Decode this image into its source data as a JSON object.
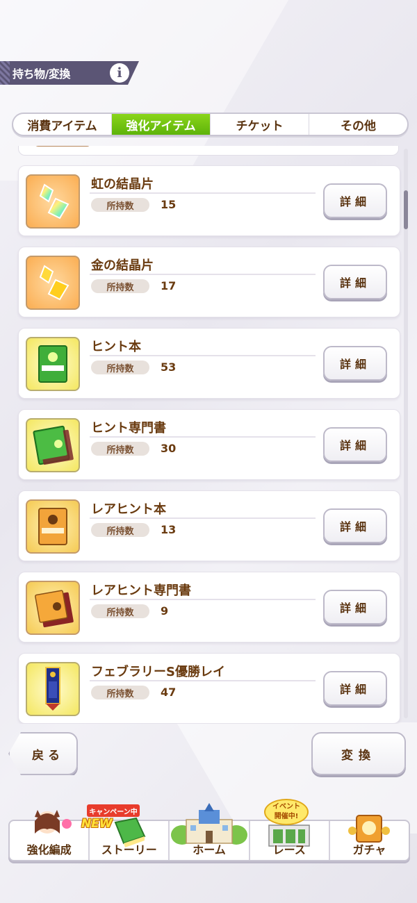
{
  "header": {
    "title": "持ち物/変換",
    "info_label": "i"
  },
  "tabs": [
    {
      "label": "消費アイテム",
      "active": false
    },
    {
      "label": "強化アイテム",
      "active": true
    },
    {
      "label": "チケット",
      "active": false
    },
    {
      "label": "その他",
      "active": false
    }
  ],
  "list": {
    "count_label": "所持数",
    "detail_label": "詳細",
    "items": [
      {
        "name": "虹の結晶片",
        "count": "15",
        "icon": "rainbow-crystal-icon"
      },
      {
        "name": "金の結晶片",
        "count": "17",
        "icon": "gold-crystal-icon"
      },
      {
        "name": "ヒント本",
        "count": "53",
        "icon": "hint-book-icon"
      },
      {
        "name": "ヒント専門書",
        "count": "30",
        "icon": "hint-textbook-icon"
      },
      {
        "name": "レアヒント本",
        "count": "13",
        "icon": "rare-hint-book-icon"
      },
      {
        "name": "レアヒント専門書",
        "count": "9",
        "icon": "rare-hint-textbook-icon"
      },
      {
        "name": "フェブラリーS優勝レイ",
        "count": "47",
        "icon": "winner-lei-icon"
      }
    ]
  },
  "buttons": {
    "back": "戻る",
    "convert": "変換"
  },
  "nav": {
    "items": [
      {
        "label": "強化編成"
      },
      {
        "label": "ストーリー"
      },
      {
        "label": "ホーム"
      },
      {
        "label": "レース"
      },
      {
        "label": "ガチャ"
      }
    ],
    "campaign_badge": "キャンペーン中",
    "new_badge": "NEW",
    "event_badge_line1": "イベント",
    "event_badge_line2": "開催中!"
  }
}
